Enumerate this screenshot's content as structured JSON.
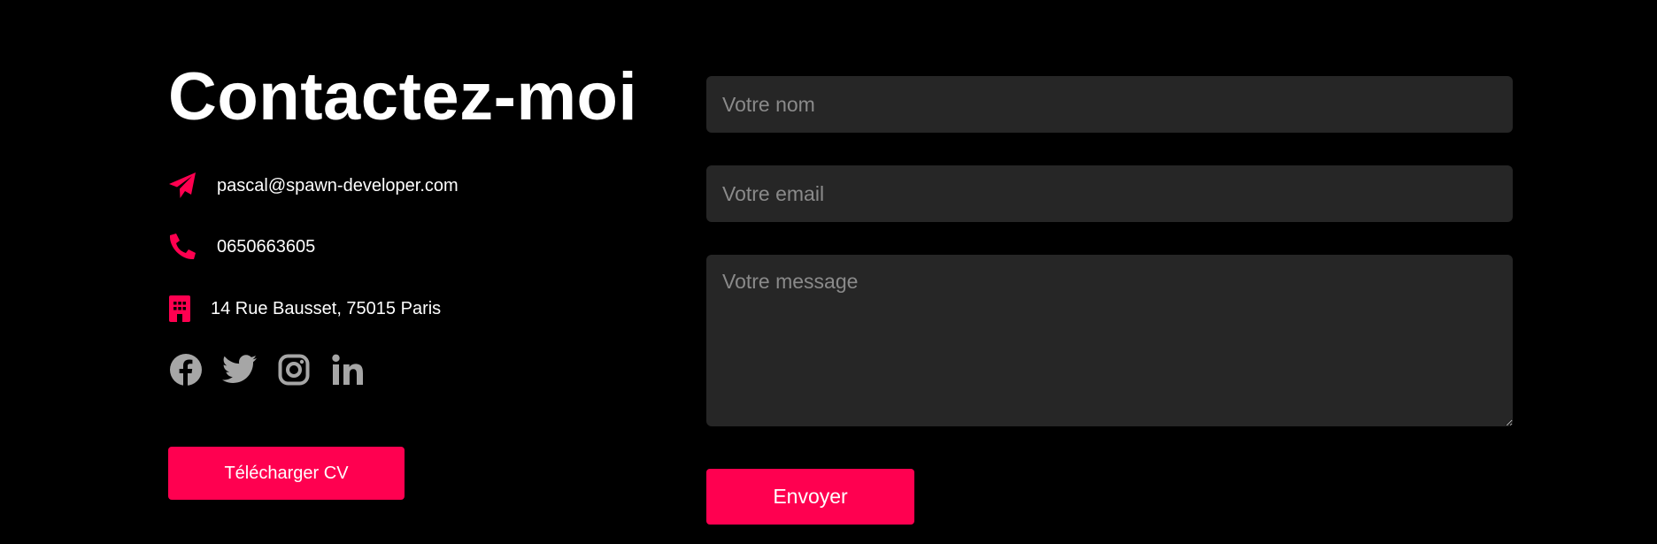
{
  "contact": {
    "title": "Contactez-moi",
    "email": "pascal@spawn-developer.com",
    "phone": "0650663605",
    "address": "14 Rue Bausset, 75015 Paris",
    "icons": {
      "email": "paper-plane-icon",
      "phone": "phone-icon",
      "address": "building-icon"
    },
    "socials": [
      "facebook-icon",
      "twitter-icon",
      "instagram-icon",
      "linkedin-icon"
    ],
    "cv_button_label": "Télécharger CV"
  },
  "form": {
    "name_placeholder": "Votre nom",
    "email_placeholder": "Votre email",
    "message_placeholder": "Votre message",
    "submit_label": "Envoyer"
  },
  "colors": {
    "background": "#000000",
    "accent": "#ff0050",
    "field_background": "#262626",
    "placeholder": "#8a8a8a",
    "social_icon": "#a6a6a6"
  }
}
